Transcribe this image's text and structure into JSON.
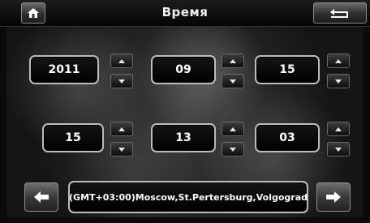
{
  "header": {
    "title": "Время",
    "home_icon": "home-icon",
    "back_icon": "return-icon"
  },
  "date": {
    "year": "2011",
    "month": "09",
    "day": "15"
  },
  "time": {
    "hour": "15",
    "minute": "13",
    "second": "03"
  },
  "timezone": {
    "label": "(GMT+03:00)Moscow,St.Pertersburg,Volgograd",
    "prev_icon": "arrow-left-icon",
    "next_icon": "arrow-right-icon"
  }
}
